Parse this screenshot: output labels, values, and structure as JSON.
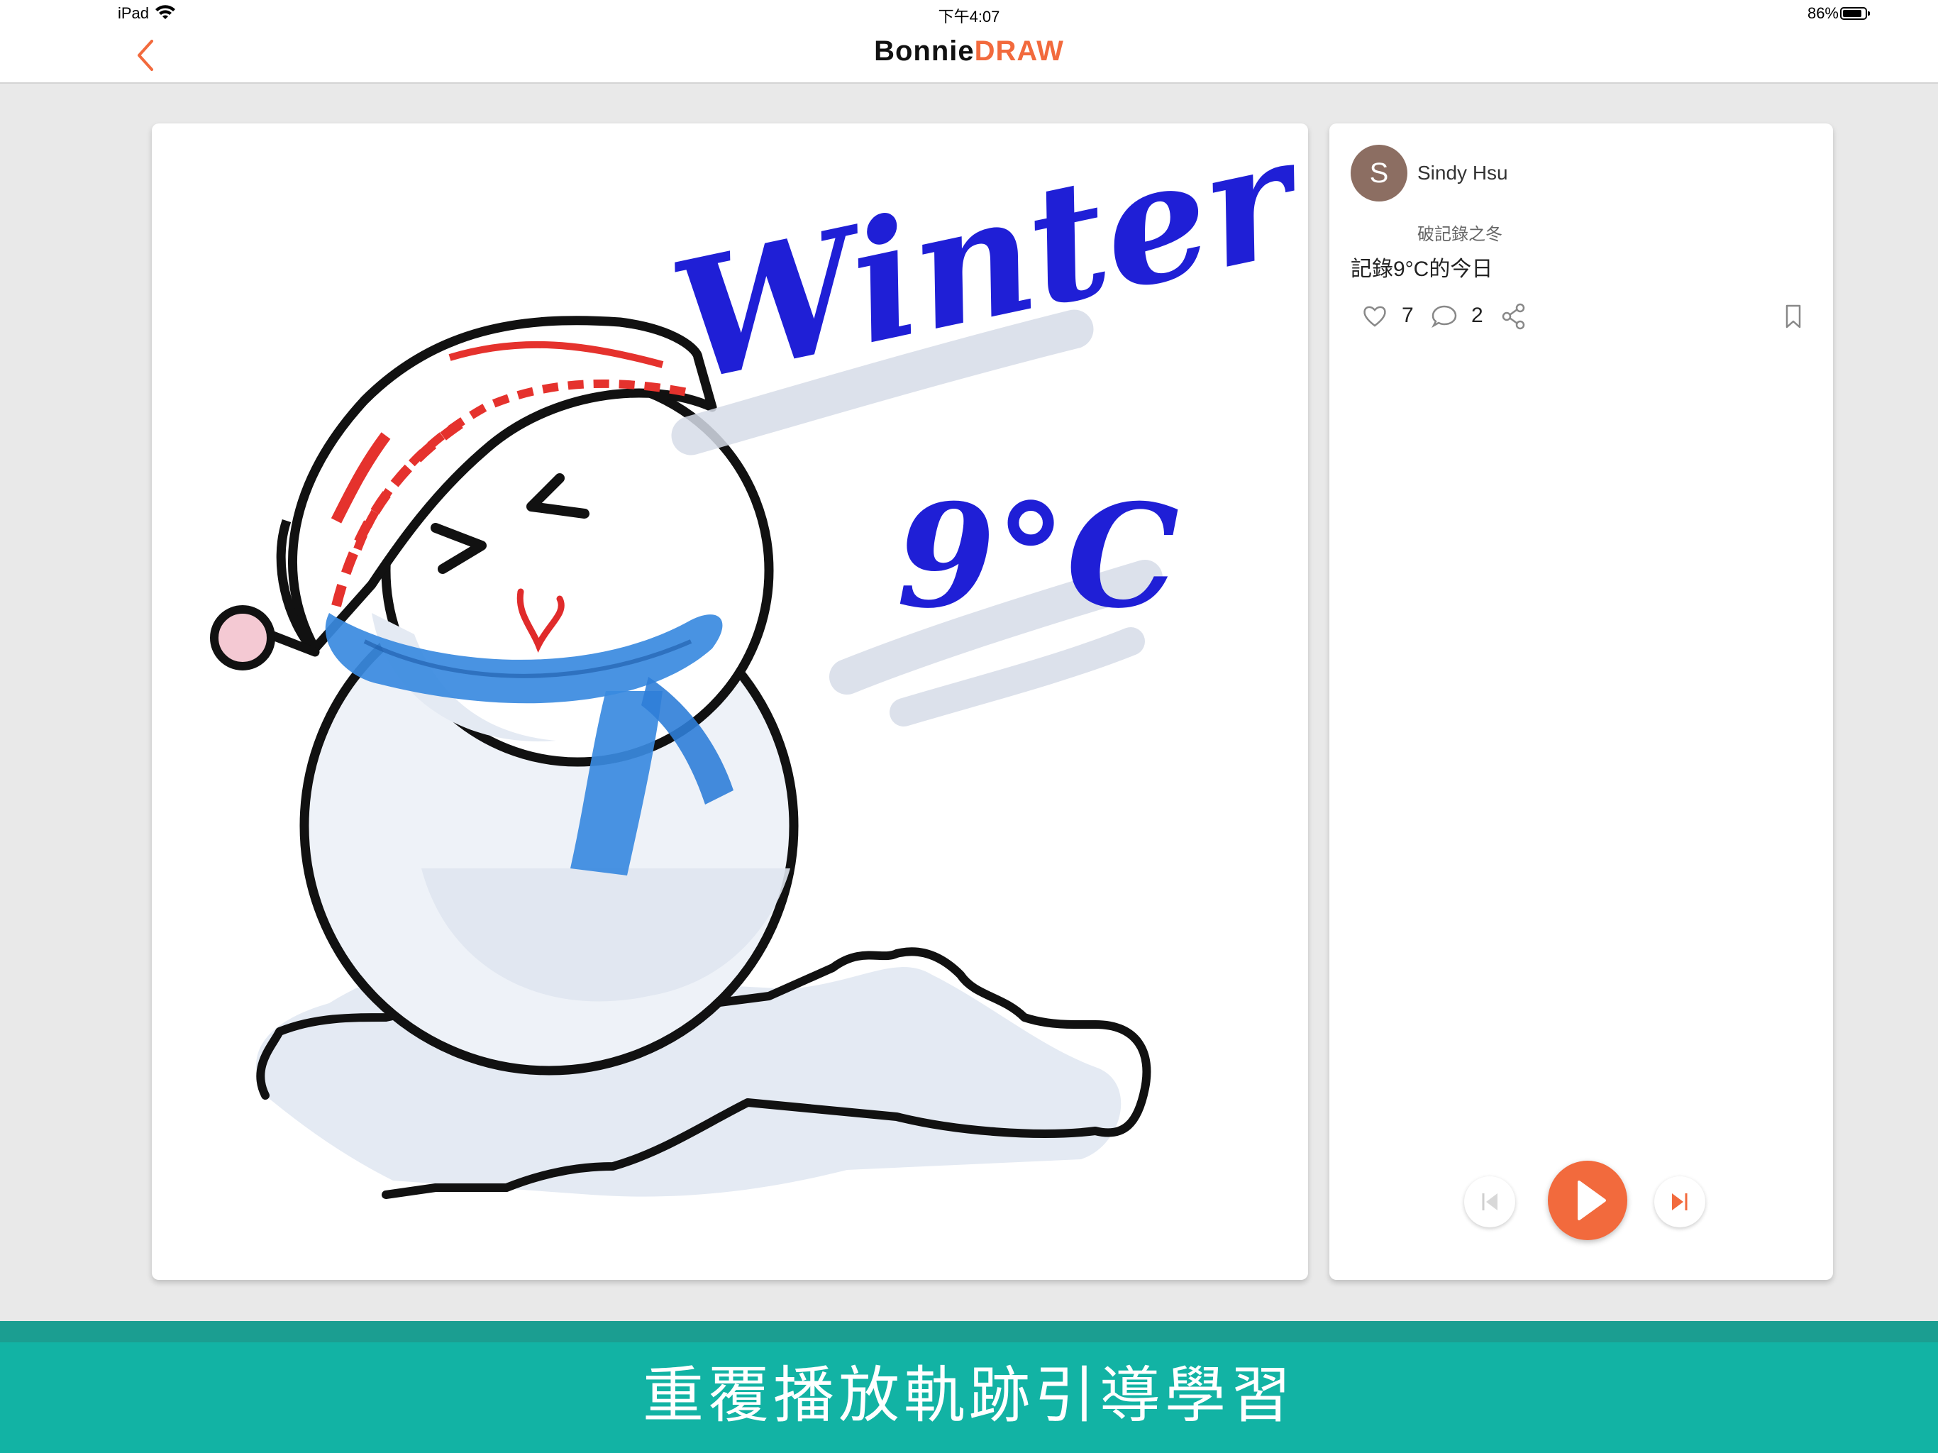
{
  "status": {
    "device": "iPad",
    "time": "下午4:07",
    "battery": "86%",
    "battery_level": 0.86
  },
  "nav": {
    "logo_part1": "Bonnie",
    "logo_part2": "DRAW"
  },
  "artwork": {
    "canvas_text": {
      "word": "Winter",
      "temp": "9°C"
    },
    "author": {
      "initial": "S",
      "name": "Sindy Hsu"
    },
    "title": "破記錄之冬",
    "description": "記錄9°C的今日",
    "likes": "7",
    "comments": "2"
  },
  "promo": {
    "text": "重覆播放軌跡引導學習"
  },
  "colors": {
    "accent": "#f26a3d",
    "teal": "#12b3a4",
    "avatar": "#8c6e62"
  }
}
